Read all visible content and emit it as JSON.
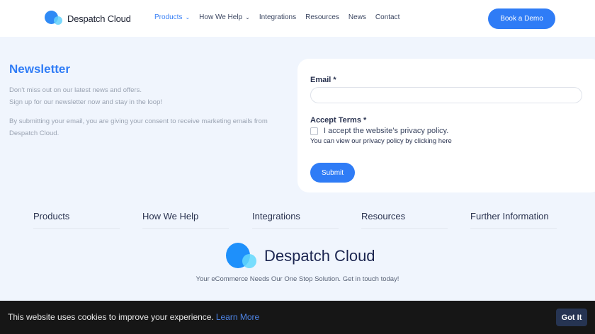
{
  "header": {
    "brand": "Despatch Cloud",
    "nav": [
      {
        "label": "Products",
        "dropdown": true
      },
      {
        "label": "How We Help",
        "dropdown": true
      },
      {
        "label": "Integrations"
      },
      {
        "label": "Resources"
      },
      {
        "label": "News"
      },
      {
        "label": "Contact"
      }
    ],
    "cta": "Book a Demo"
  },
  "newsletter": {
    "title": "Newsletter",
    "line1": "Don't miss out on our latest news and offers.",
    "line2": "Sign up for our newsletter now and stay in the loop!",
    "consent": "By submitting your email, you are giving your consent to receive marketing emails from Despatch Cloud."
  },
  "form": {
    "email_label": "Email *",
    "email_value": "",
    "terms_label": "Accept Terms *",
    "checkbox_label": "I accept the website’s privacy policy.",
    "policy_text": "You can view our privacy policy by clicking here",
    "submit": "Submit"
  },
  "footer": {
    "columns": [
      "Products",
      "How We Help",
      "Integrations",
      "Resources",
      "Further Information"
    ],
    "brand": "Despatch Cloud",
    "tagline": "Your eCommerce Needs Our One Stop Solution. Get in touch today!"
  },
  "cookie": {
    "text": "This website uses cookies to improve your experience.",
    "link": "Learn More",
    "button": "Got It"
  },
  "colors": {
    "accent": "#2f7cf6",
    "background": "#f0f5fd",
    "cookie_bar": "#161616"
  }
}
